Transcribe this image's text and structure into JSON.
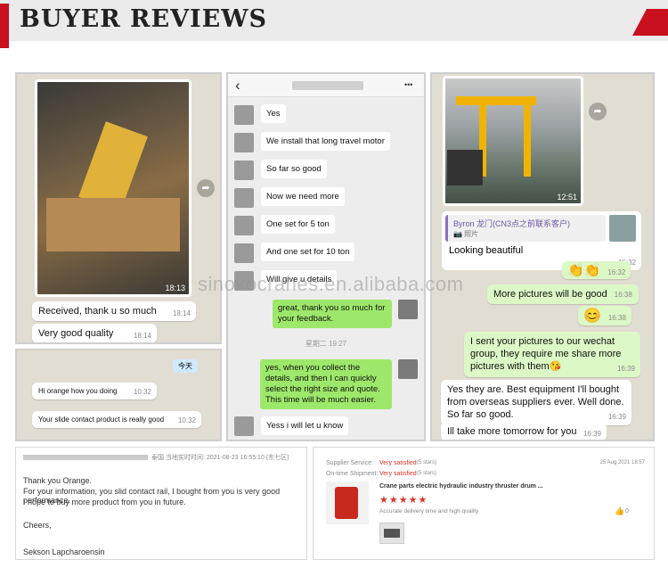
{
  "header": {
    "title": "BUYER REVIEWS"
  },
  "watermark": "sinokocranes.en.alibaba.com",
  "panel1": {
    "photo_time": "18:13",
    "messages": [
      {
        "text": "Received, thank u so much",
        "time": "18:14"
      },
      {
        "text": "Very good quality",
        "time": "18:14"
      }
    ]
  },
  "panel2": {
    "back": "‹",
    "more": "•••",
    "incoming": [
      "Yes",
      "We install that long travel motor",
      "So far so good",
      "Now we need more",
      "One set for 5 ton",
      "And one set for 10 ton",
      "Will give u details"
    ],
    "reply1": "great, thank you so much for your feedback.",
    "divider": "星期二 19:27",
    "reply2": "yes, when you collect the details, and then I can quickly select the right size and quote. This time will be much easier.",
    "last": "Yess i will let u know"
  },
  "panel3": {
    "photo_time": "12:51",
    "quote_name": "Byron 龙门(CN3点之前联系客户)",
    "quote_sub": "📷 照片",
    "messages": [
      {
        "text": "Looking beautiful",
        "time": "16:32",
        "side": "in"
      },
      {
        "text": "👏👏",
        "time": "16:32",
        "side": "out"
      },
      {
        "text": "More pictures will be good",
        "time": "16:38",
        "side": "out"
      },
      {
        "text": "😊",
        "time": "16:38",
        "side": "out"
      },
      {
        "text": "I sent your pictures to our wechat group, they require me share more pictures with them😘",
        "time": "16:39",
        "side": "out"
      },
      {
        "text": "Yes they are. Best equipment I'll bought from overseas suppliers ever. Well done. So far so good.",
        "time": "16:39",
        "side": "in"
      },
      {
        "text": "Ill take more tomorrow for you",
        "time": "16:39",
        "side": "in"
      }
    ]
  },
  "panel4": {
    "tag": "今天",
    "messages": [
      {
        "text": "Hi orange how you doing",
        "time": "10:32"
      },
      {
        "text": "Your slide contact product is really good",
        "time": "10:32"
      }
    ]
  },
  "email": {
    "meta": "泰国 当地实时时间: 2021-08-23 16:55:10 (东七区)",
    "greeting": "Thank you Orange.",
    "body1": "For your information, you slid contact rail, I bought from you is very good performance.",
    "body2": "I hope to buy more product from you in future.",
    "closing": "Cheers,",
    "signature": "Sekson Lapcharoensin"
  },
  "review": {
    "supplier_label": "Supplier Service:",
    "supplier_value": "Very satisfied",
    "supplier_stars": "(5 stars)",
    "shipment_label": "On-time Shipment:",
    "shipment_value": "Very satisfied",
    "shipment_stars": "(5 stars)",
    "date": "25 Aug 2021 18:57",
    "product": "Crane parts electric hydraulic industry thruster drum ...",
    "stars": "★★★★★",
    "comment": "Accurate delivery time and high quality",
    "likes": "0"
  }
}
